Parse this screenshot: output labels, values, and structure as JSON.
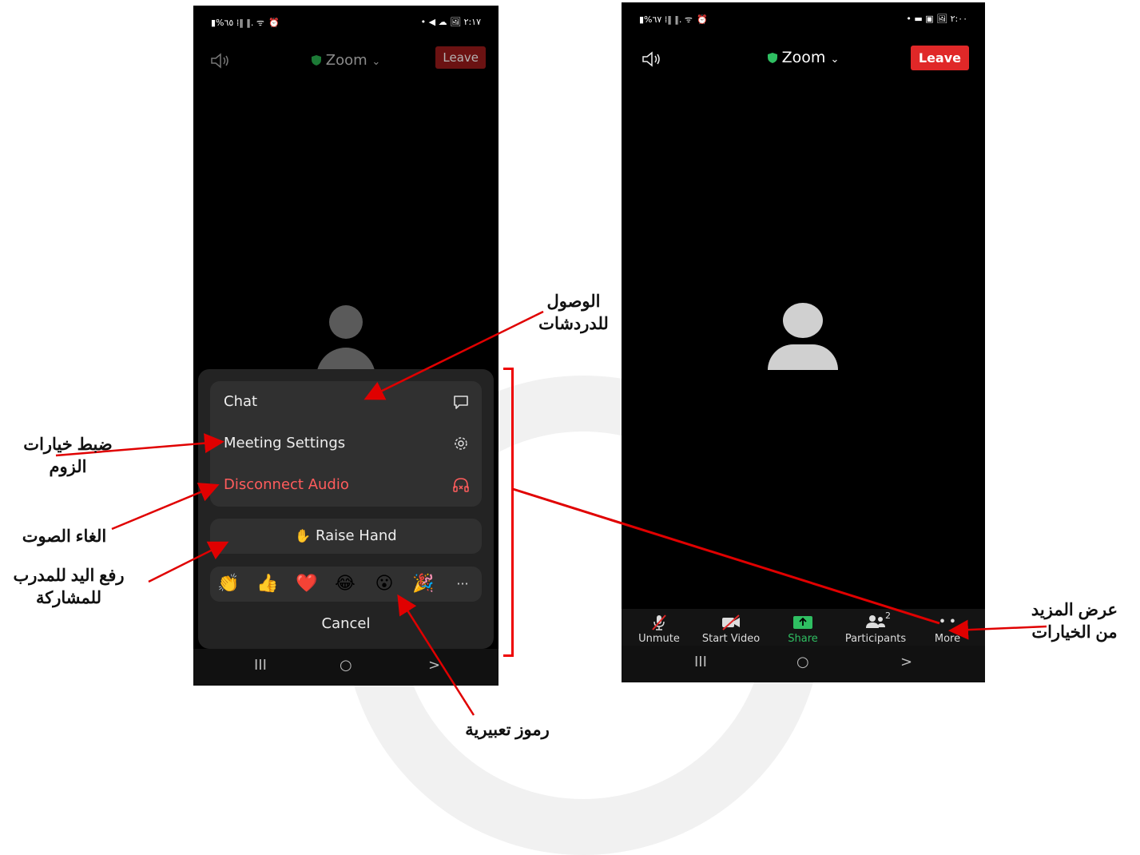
{
  "left_phone": {
    "status_left": "▮%٦٥ ⁞‖ ‖. ᯤ ⏰",
    "status_right": "• ◀ ☁ 🖼 ٢:١٧",
    "title": "Zoom",
    "chevron": "⌄",
    "leave_label": "Leave",
    "menu": {
      "chat_label": "Chat",
      "chat_icon": "chat-bubble-icon",
      "settings_label": "Meeting Settings",
      "settings_icon": "gear-icon",
      "disconnect_label": "Disconnect Audio",
      "disconnect_icon": "headphones-off-icon",
      "raise_hand_label": "Raise Hand",
      "raise_hand_emoji": "✋",
      "reactions": [
        "👏",
        "👍",
        "❤️",
        "😂",
        "😮",
        "🎉",
        "···"
      ],
      "cancel_label": "Cancel"
    },
    "nav": [
      "III",
      "○",
      ">"
    ]
  },
  "right_phone": {
    "status_left": "▮%٦٧ ⁞‖ ‖. ᯤ ⏰",
    "status_right": "• ▬ ▣ 🖼 ٢:٠٠",
    "title": "Zoom",
    "chevron": "⌄",
    "leave_label": "Leave",
    "toolbar": {
      "unmute_label": "Unmute",
      "start_video_label": "Start Video",
      "share_label": "Share",
      "participants_label": "Participants",
      "participants_count": "2",
      "more_label": "More",
      "more_glyph": "• •"
    },
    "nav": [
      "III",
      "○",
      ">"
    ]
  },
  "annotations": {
    "chat_access": "الوصول\nللدردشات",
    "zoom_settings": "ضبط خيارات\nالزوم",
    "mute_audio": "الغاء الصوت",
    "raise_hand": "رفع اليد للمدرب\nللمشاركة",
    "emojis": "رموز تعبيرية",
    "more_options": "عرض المزيد\nمن الخيارات"
  },
  "colors": {
    "leave_red": "#e02828",
    "arrow_red": "#e00000",
    "share_green": "#2fbf62",
    "disconnect_red": "#ff5c5c"
  }
}
